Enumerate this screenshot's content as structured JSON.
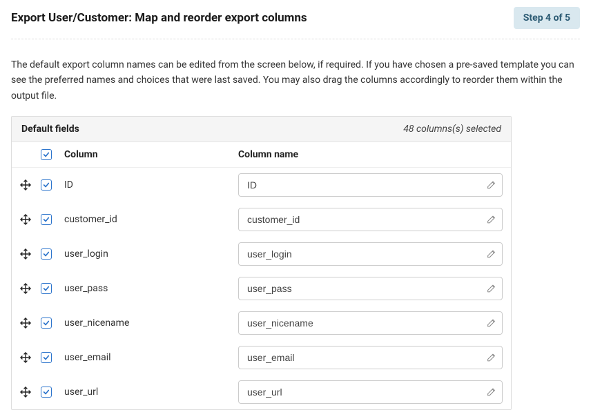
{
  "header": {
    "title": "Export User/Customer: Map and reorder export columns",
    "step_label": "Step 4 of 5"
  },
  "description": "The default export column names can be edited from the screen below, if required. If you have chosen a pre-saved template you can see the preferred names and choices that were last saved. You may also drag the columns accordingly to reorder them within the output file.",
  "table": {
    "section_label": "Default fields",
    "selected_summary": "48 columns(s) selected",
    "header_col_src": "Column",
    "header_col_name": "Column name",
    "rows": [
      {
        "src": "ID",
        "name": "ID"
      },
      {
        "src": "customer_id",
        "name": "customer_id"
      },
      {
        "src": "user_login",
        "name": "user_login"
      },
      {
        "src": "user_pass",
        "name": "user_pass"
      },
      {
        "src": "user_nicename",
        "name": "user_nicename"
      },
      {
        "src": "user_email",
        "name": "user_email"
      },
      {
        "src": "user_url",
        "name": "user_url"
      }
    ]
  }
}
